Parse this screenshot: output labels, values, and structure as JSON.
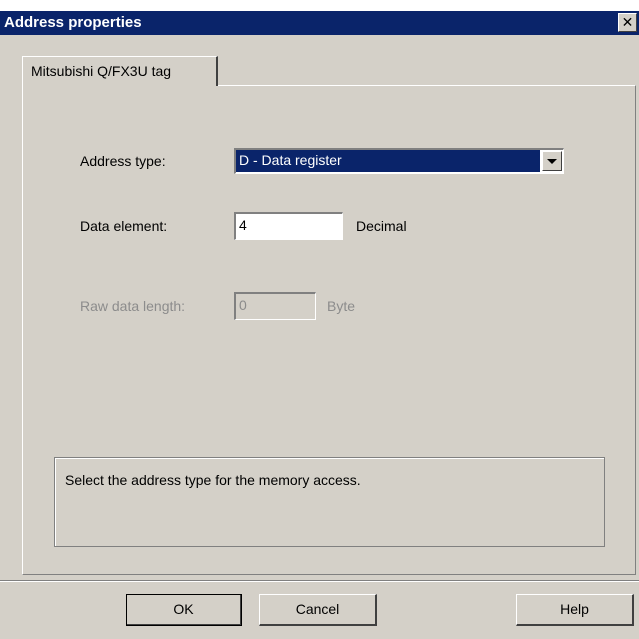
{
  "window": {
    "title": "Address properties",
    "close_glyph": "✕"
  },
  "tabs": [
    {
      "label": "Mitsubishi Q/FX3U tag"
    }
  ],
  "form": {
    "address_type": {
      "label": "Address type:",
      "value": "D - Data register"
    },
    "data_element": {
      "label": "Data element:",
      "value": "4",
      "unit": "Decimal"
    },
    "raw_data_length": {
      "label": "Raw data length:",
      "value": "0",
      "unit": "Byte",
      "disabled": true
    }
  },
  "description": "Select the address type for the memory access.",
  "buttons": {
    "ok": "OK",
    "cancel": "Cancel",
    "help": "Help"
  },
  "colors": {
    "title_bar": "#0a246a",
    "dialog_bg": "#d4d0c8",
    "selection": "#0a246a"
  }
}
